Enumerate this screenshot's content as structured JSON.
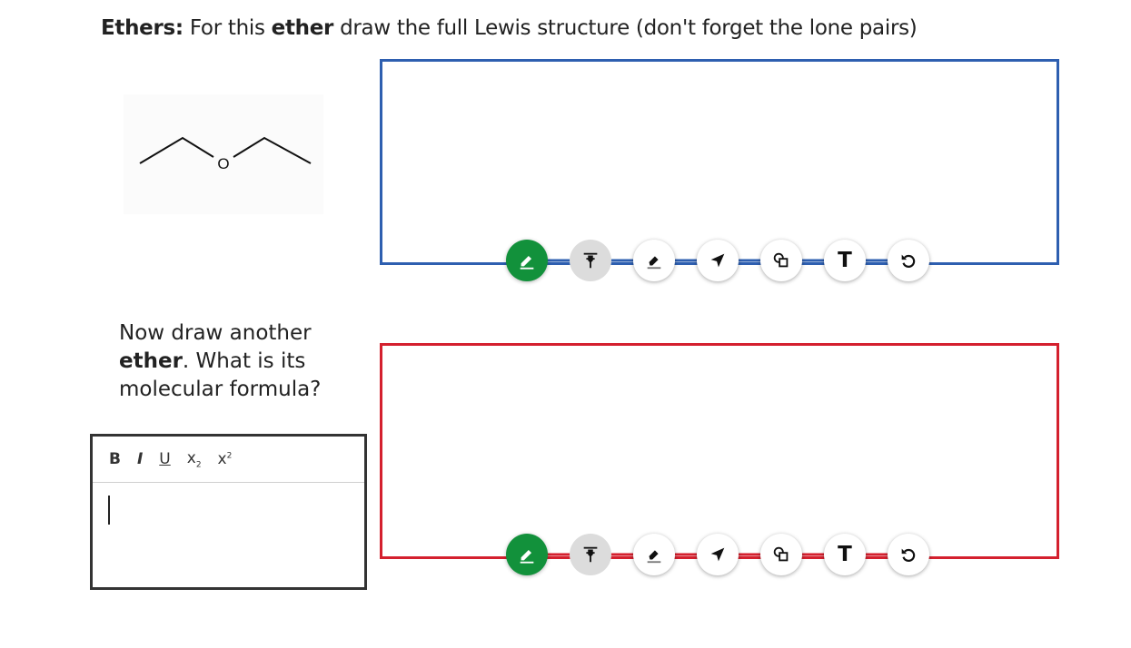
{
  "question": {
    "prefix_bold": "Ethers:",
    "text_before": " For this ",
    "ether_bold": "ether",
    "text_after": " draw the full Lewis structure (don't forget the lone pairs)"
  },
  "molecule": {
    "atom_label": "O"
  },
  "toolbar_icons": [
    "pencil-icon",
    "highlighter-icon",
    "eraser-icon",
    "pointer-arrow-icon",
    "shapes-icon",
    "text-icon",
    "undo-icon"
  ],
  "toolbar": {
    "text_tool_label": "T"
  },
  "prompt": {
    "line1": "Now draw another",
    "bold_word": "ether",
    "line2_rest": ". What is its",
    "line3": "molecular formula?"
  },
  "editor": {
    "bold": "B",
    "italic": "I",
    "underline": "U",
    "subscript": "x",
    "subscript_mark": "2",
    "superscript": "x",
    "superscript_mark": "2",
    "value": ""
  },
  "colors": {
    "canvas1_border": "#2e5fb0",
    "canvas2_border": "#d4202e",
    "active_tool": "#12913b",
    "disabled_tool": "#dcdcdc"
  }
}
